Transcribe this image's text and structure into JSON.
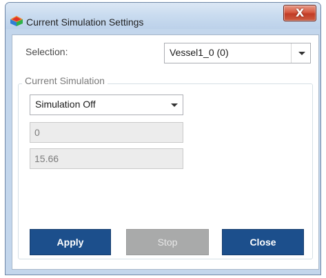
{
  "window": {
    "title": "Current Simulation Settings",
    "close_glyph": "X",
    "icon": "app-color-icon"
  },
  "selection": {
    "label": "Selection:",
    "value": "Vessel1_0 (0)"
  },
  "current_simulation": {
    "legend": "Current Simulation",
    "mode_value": "Simulation Off",
    "field1_value": "0",
    "field2_value": "15.66"
  },
  "buttons": {
    "apply": "Apply",
    "stop": "Stop",
    "close": "Close"
  },
  "colors": {
    "primary_button": "#1c4f8c",
    "disabled_button": "#a9aaaa",
    "close_button": "#c13c26",
    "title_bar": "#c9dbef"
  }
}
